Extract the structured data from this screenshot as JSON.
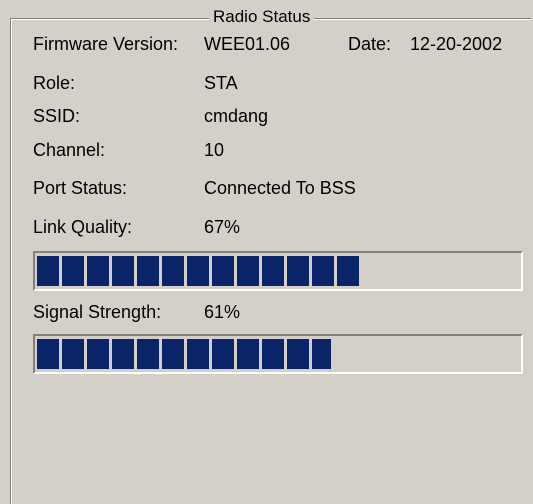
{
  "groupbox": {
    "title": "Radio Status"
  },
  "firmware": {
    "label": "Firmware Version:",
    "value": "WEE01.06",
    "date_label": "Date:",
    "date_value": "12-20-2002"
  },
  "role": {
    "label": "Role:",
    "value": "STA"
  },
  "ssid": {
    "label": "SSID:",
    "value": "cmdang"
  },
  "channel": {
    "label": "Channel:",
    "value": "10"
  },
  "port_status": {
    "label": "Port Status:",
    "value": "Connected To BSS"
  },
  "link_quality": {
    "label": "Link Quality:",
    "value": "67%",
    "level": 0.67
  },
  "signal_strength": {
    "label": "Signal Strength:",
    "value": "61%",
    "level": 0.61
  },
  "colors": {
    "window_bg": "#d4d0c8",
    "progress_fill": "#0a246a"
  }
}
